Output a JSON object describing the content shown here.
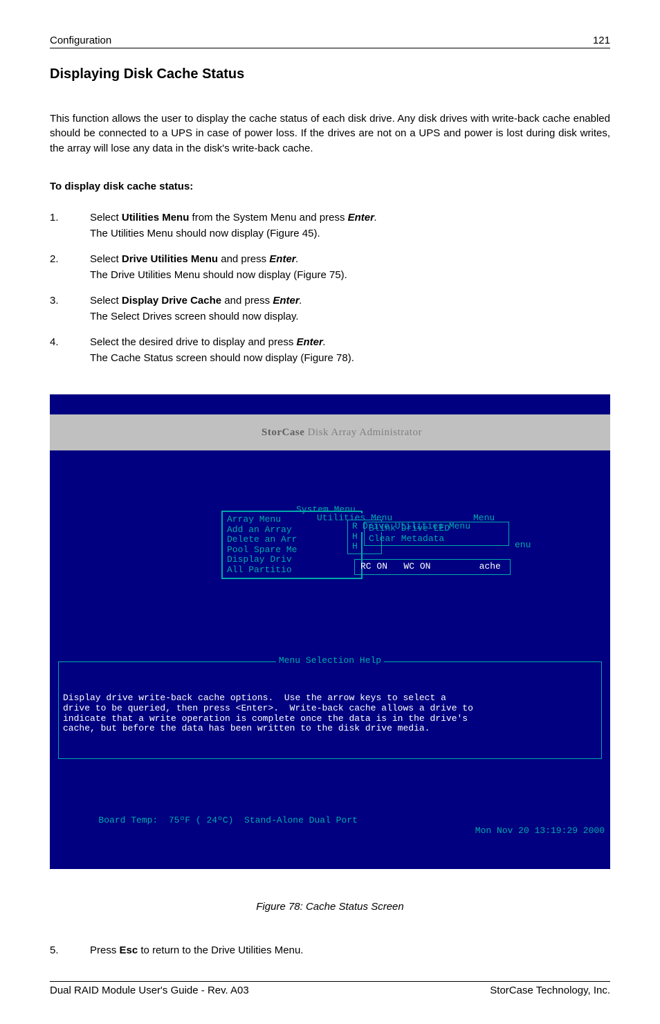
{
  "header": {
    "left": "Configuration",
    "right": "121"
  },
  "title": "Displaying Disk Cache Status",
  "intro": "This function allows the user to display the cache status of each disk drive.  Any disk drives with write-back cache enabled should be connected to a UPS in case of power loss.  If the drives are not on a UPS and power is lost during disk writes, the array will lose any data in the disk's write-back cache.",
  "subhead": "To display disk cache status:",
  "steps": [
    {
      "num": "1.",
      "first_pre": "Select ",
      "first_bold": "Utilities Menu",
      "first_mid": " from the System Menu and press ",
      "first_key": "Enter",
      "first_post": ".",
      "second": "The Utilities Menu should now display (Figure 45)."
    },
    {
      "num": "2.",
      "first_pre": "Select ",
      "first_bold": "Drive Utilities Menu",
      "first_mid": " and press ",
      "first_key": "Enter",
      "first_post": ".",
      "second": "The Drive Utilities Menu should now display (Figure 75)."
    },
    {
      "num": "3.",
      "first_pre": "Select ",
      "first_bold": "Display Drive Cache",
      "first_mid": " and press ",
      "first_key": "Enter",
      "first_post": ".",
      "second": "The Select Drives screen should now display."
    },
    {
      "num": "4.",
      "first_pre": "Select the desired drive to display and press ",
      "first_bold": "",
      "first_mid": "",
      "first_key": "Enter",
      "first_post": ".",
      "second": "The Cache Status screen should now display (Figure 78)."
    }
  ],
  "term": {
    "title_brand": "StorCase",
    "title_rest": " Disk Array Administrator",
    "sys_label": "System Menu",
    "sys_items": "Array Menu\nAdd an Array\nDelete an Arr\nPool Spare Me\nDisplay Driv\nAll Partitio",
    "util_label": "Utilities Menu",
    "util_items": "R\nH\nH",
    "drive_label": "Drive Utilities Menu",
    "drive_items": "Blink Drive LED\nClear Metadata",
    "menu_tag": "Menu",
    "enu_tag": "enu",
    "status_text": "RC ON   WC ON         ache",
    "help_label": "Menu Selection Help",
    "help_text": "Display drive write-back cache options.  Use the arrow keys to select a\ndrive to be queried, then press <Enter>.  Write-back cache allows a drive to\nindicate that a write operation is complete once the data is in the drive's\ncache, but before the data has been written to the disk drive media.",
    "status_left": "Board Temp:  75ºF ( 24ºC)  Stand-Alone Dual Port",
    "status_right": "Mon Nov 20 13:19:29 2000"
  },
  "figure_caption": "Figure 78: Cache Status Screen",
  "step5": {
    "num": "5.",
    "pre": "Press ",
    "bold": "Esc",
    "post": " to return to the Drive Utilities Menu."
  },
  "footer": {
    "left": "Dual RAID Module User's Guide - Rev. A03",
    "right": "StorCase Technology, Inc."
  }
}
